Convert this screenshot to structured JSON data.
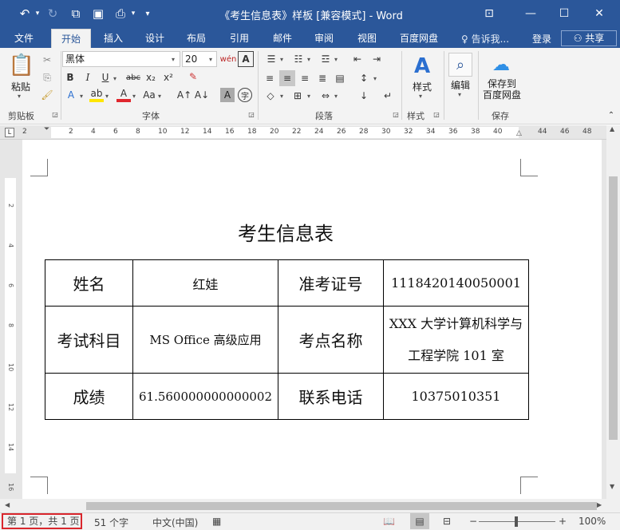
{
  "window": {
    "title": "《考生信息表》样板 [兼容模式] - Word"
  },
  "tabs": [
    {
      "label": "文件"
    },
    {
      "label": "开始"
    },
    {
      "label": "插入"
    },
    {
      "label": "设计"
    },
    {
      "label": "布局"
    },
    {
      "label": "引用"
    },
    {
      "label": "邮件"
    },
    {
      "label": "审阅"
    },
    {
      "label": "视图"
    },
    {
      "label": "百度网盘"
    }
  ],
  "tell_me": "告诉我...",
  "login": "登录",
  "share": "共享",
  "ribbon": {
    "paste_label": "粘贴",
    "clipboard_label": "剪贴板",
    "font_name": "黑体",
    "font_size": "20",
    "font_group_label": "字体",
    "paragraph_label": "段落",
    "styles_big_label": "样式",
    "styles_group_label": "样式",
    "edit_label": "编辑",
    "save_baidu_label": "保存到\n百度网盘",
    "save_group_label": "保存"
  },
  "document": {
    "title": "考生信息表",
    "rows": [
      [
        "姓名",
        "红娃",
        "准考证号",
        "1118420140050001"
      ],
      [
        "考试科目",
        "MS Office 高级应用",
        "考点名称",
        "XXX 大学计算机科学与工程学院 101 室"
      ],
      [
        "成绩",
        "61.560000000000002",
        "联系电话",
        "10375010351"
      ]
    ]
  },
  "ruler_numbers": [
    "2",
    "2",
    "4",
    "6",
    "8",
    "10",
    "12",
    "14",
    "16",
    "18",
    "20",
    "22",
    "24",
    "26",
    "28",
    "30",
    "32",
    "34",
    "36",
    "38",
    "40",
    "44",
    "46",
    "48"
  ],
  "status": {
    "page": "第 1 页，共 1 页",
    "words": "51 个字",
    "language": "中文(中国)",
    "zoom": "100%"
  }
}
